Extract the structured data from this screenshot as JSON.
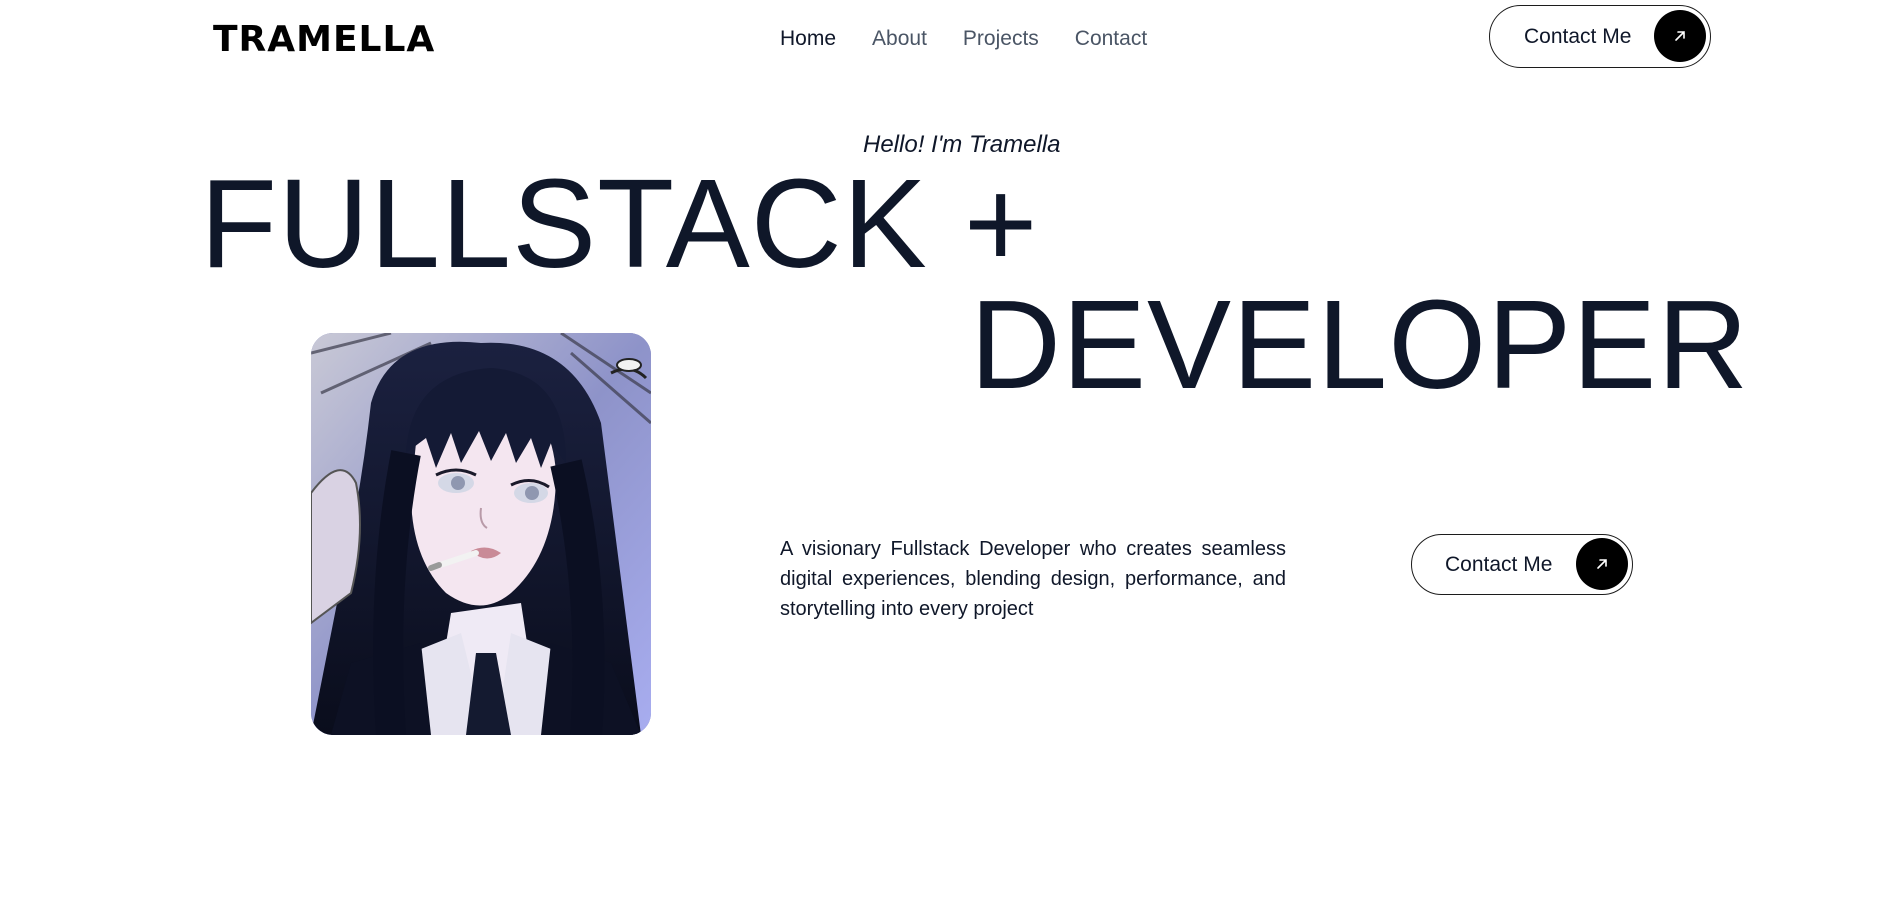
{
  "header": {
    "logo": "TRAMELLA",
    "nav": [
      {
        "label": "Home",
        "active": true
      },
      {
        "label": "About",
        "active": false
      },
      {
        "label": "Projects",
        "active": false
      },
      {
        "label": "Contact",
        "active": false
      }
    ],
    "cta_label": "Contact Me",
    "cta_icon": "arrow-up-right-icon"
  },
  "hero": {
    "greeting": "Hello! I'm Tramella",
    "title_line_1": "FULLSTACK +",
    "title_line_2": "DEVELOPER",
    "bio": "A visionary Fullstack Developer who creates seamless digital experiences, blending design, performance, and storytelling into every project",
    "cta_label": "Contact Me",
    "cta_icon": "arrow-up-right-icon"
  },
  "colors": {
    "text": "#0f1729",
    "muted_nav": "#4a5565",
    "button_icon_bg": "#000000",
    "background": "#ffffff"
  }
}
